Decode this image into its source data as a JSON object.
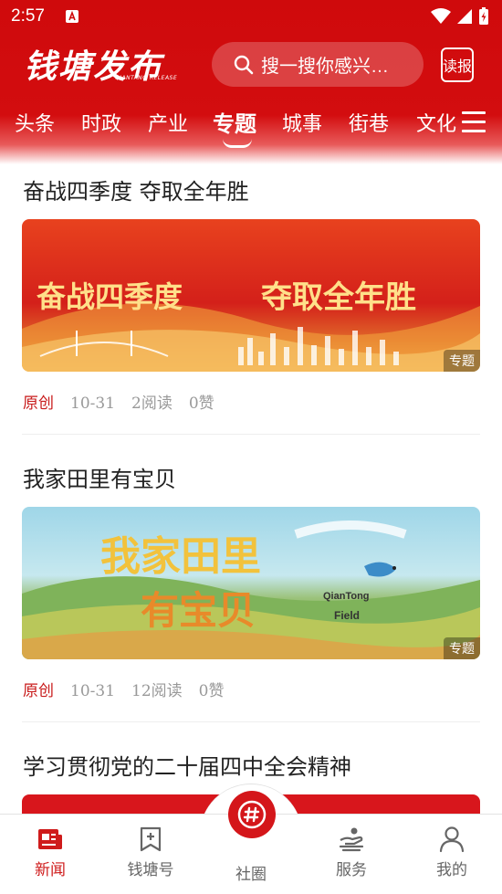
{
  "status_bar": {
    "time": "2:57"
  },
  "header": {
    "logo_text": "钱塘发布",
    "logo_sub": "QIANTANG RELEASE",
    "search_placeholder": "搜一搜你感兴…",
    "read_button": "读报"
  },
  "tabs": [
    {
      "label": "头条",
      "active": false
    },
    {
      "label": "时政",
      "active": false
    },
    {
      "label": "产业",
      "active": false
    },
    {
      "label": "专题",
      "active": true
    },
    {
      "label": "城事",
      "active": false
    },
    {
      "label": "街巷",
      "active": false
    },
    {
      "label": "文化",
      "active": false
    }
  ],
  "articles": [
    {
      "title": "奋战四季度  夺取全年胜",
      "image_text_1": "奋战四季度",
      "image_text_2": "夺取全年胜",
      "tag": "专题",
      "source": "原创",
      "date": "10-31",
      "reads": "2阅读",
      "likes": "0赞"
    },
    {
      "title": "我家田里有宝贝",
      "image_text_1": "我家田里",
      "image_text_2": "有宝贝",
      "image_badge_1": "QianTong",
      "image_badge_2": "Field",
      "tag": "专题",
      "source": "原创",
      "date": "10-31",
      "reads": "12阅读",
      "likes": "0赞"
    },
    {
      "title": "学习贯彻党的二十届四中全会精神"
    }
  ],
  "bottom_nav": {
    "items": [
      {
        "label": "新闻",
        "icon": "news-icon",
        "active": true
      },
      {
        "label": "钱塘号",
        "icon": "bookmark-plus-icon",
        "active": false
      },
      {
        "label": "社圈",
        "icon": "hashtag-icon",
        "active": false
      },
      {
        "label": "服务",
        "icon": "service-icon",
        "active": false
      },
      {
        "label": "我的",
        "icon": "profile-icon",
        "active": false
      }
    ]
  },
  "colors": {
    "brand_red": "#cf0a0c",
    "accent_red": "#c81a1a",
    "meta_gray": "#999999"
  }
}
